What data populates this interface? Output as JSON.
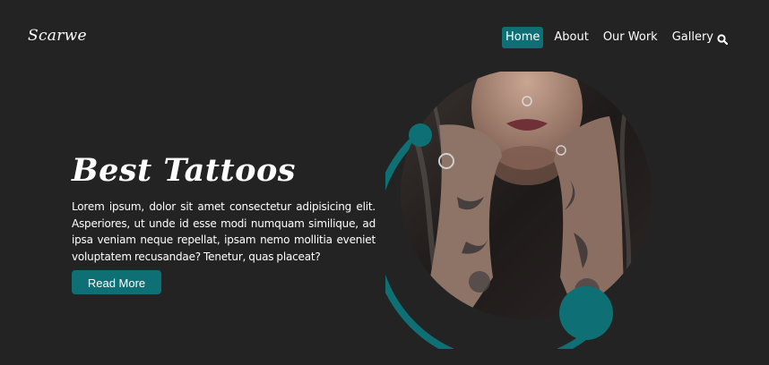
{
  "brand": {
    "logo_text": "Scarwe"
  },
  "nav": {
    "items": [
      {
        "label": "Home",
        "active": true
      },
      {
        "label": "About",
        "active": false
      },
      {
        "label": "Our Work",
        "active": false
      },
      {
        "label": "Gallery",
        "active": false
      }
    ],
    "search_icon": "search-icon"
  },
  "hero": {
    "title": "Best Tattoos",
    "text": "Lorem ipsum, dolor sit amet consectetur adipisicing elit. Asperiores, ut unde id esse modi numquam similique, ad ipsa veniam neque repellat, ipsam nemo mollitia eveniet voluptatem recusandae? Tenetur, quas placeat?",
    "button_label": "Read More"
  },
  "colors": {
    "background": "#232323",
    "accent": "#0e7075",
    "text": "#ffffff"
  }
}
